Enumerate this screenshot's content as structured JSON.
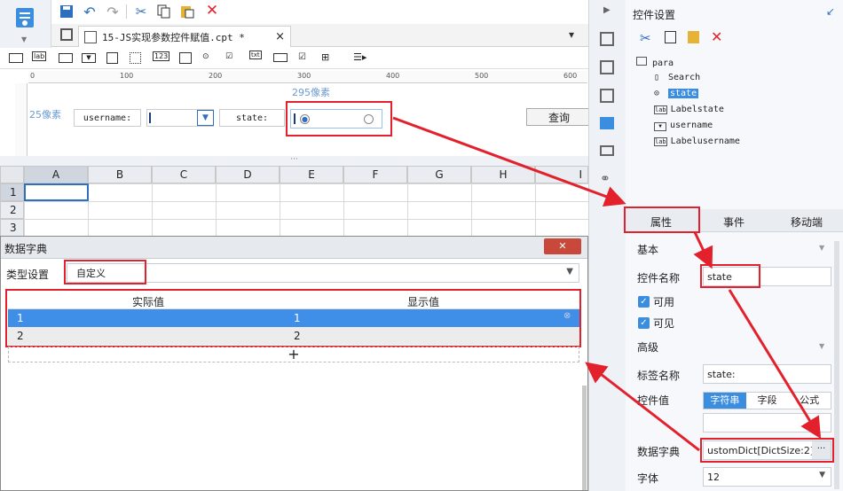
{
  "toolbar": {
    "icons": [
      "save-icon",
      "undo-icon",
      "redo-icon",
      "cut-icon",
      "copy-icon",
      "paste-icon",
      "delete-icon"
    ]
  },
  "tab": {
    "title": "15-JS实现参数控件赋值.cpt *",
    "close": "×"
  },
  "widgetbar": {
    "labels": [
      "lab",
      "123",
      "txt"
    ]
  },
  "ruler": {
    "ticks": [
      "0",
      "100",
      "200",
      "300",
      "400",
      "500",
      "600"
    ]
  },
  "canvas": {
    "label_295": "295像素",
    "label_25": "25像素",
    "username_label": "username:",
    "state_label": "state:",
    "query_button": "查询"
  },
  "sheet": {
    "columns": [
      "A",
      "B",
      "C",
      "D",
      "E",
      "F",
      "G",
      "H",
      "I"
    ],
    "rows": [
      "1",
      "2",
      "3"
    ],
    "splitter": "···"
  },
  "dialog": {
    "title": "数据字典",
    "type_label": "类型设置",
    "type_value": "自定义",
    "col_actual": "实际值",
    "col_display": "显示值",
    "rows": [
      {
        "actual": "1",
        "display": "1"
      },
      {
        "actual": "2",
        "display": "2"
      }
    ],
    "add": "+",
    "close": "✕"
  },
  "rpanel": {
    "title": "控件设置",
    "tree": {
      "root": "para",
      "items": [
        "Search",
        "state",
        "Labelstate",
        "username",
        "Labelusername"
      ]
    },
    "tabs": [
      "属性",
      "事件",
      "移动端"
    ],
    "basic": "基本",
    "name_label": "控件名称",
    "name_value": "state",
    "enabled": "可用",
    "visible": "可见",
    "advanced": "高级",
    "tag_label": "标签名称",
    "tag_value": "state:",
    "value_label": "控件值",
    "value_tabs": [
      "字符串",
      "字段",
      "公式"
    ],
    "dict_label": "数据字典",
    "dict_value": "ustomDict[DictSize:2]",
    "dict_btn": "···",
    "font_label": "字体",
    "font_value": "12"
  },
  "colors": {
    "accent": "#3b8de0",
    "red": "#e3212c",
    "selected_row": "#3f8ee8"
  }
}
